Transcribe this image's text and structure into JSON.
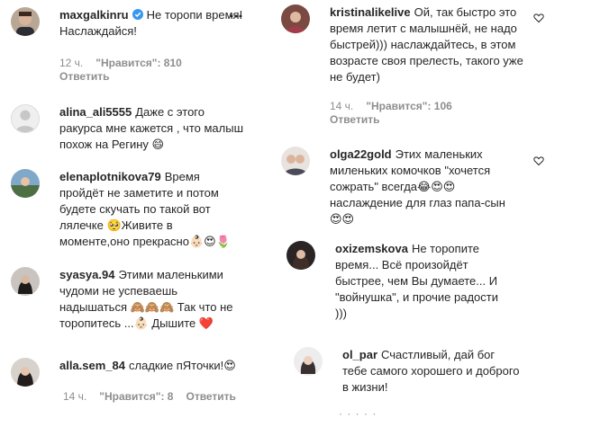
{
  "comments_left": [
    {
      "username": "maxgalkinru",
      "verified": true,
      "text": "Не торопи время! Наслаждайся!",
      "time": "12 ч.",
      "likes": "\"Нравится\": 810",
      "reply": "Ответить"
    },
    {
      "username": "alina_ali5555",
      "text": "Даже с этого ракурса мне кажется , что малыш похож на Регину",
      "emoji": "😄"
    },
    {
      "username": "elenaplotnikova79",
      "text": "Время пройдёт не заметите и потом будете скучать по такой вот лялечке 🥺Живите в моменте,оно прекрасно",
      "emoji": "👶🏻😍🌷"
    },
    {
      "username": "syasya.94",
      "text1": "Этими маленькими чудоми не успеваешь надышаться",
      "emoji1": "🙈🙈🙈",
      "text2": "Так что не торопитесь ...",
      "emoji2": "👶🏻",
      "text3": "Дышите",
      "emoji3": "❤️"
    },
    {
      "username": "alla.sem_84",
      "text": "сладкие пЯточки!",
      "emoji": "😍",
      "time": "14 ч.",
      "likes": "\"Нравится\": 8",
      "reply": "Ответить"
    }
  ],
  "comments_right": [
    {
      "username": "kristinalikelive",
      "text": "Ой, так быстро это время летит с малышнёй, не надо быстрей))) наслаждайтесь, в этом возрасте своя прелесть, такого уже не будет)",
      "time": "14 ч.",
      "likes": "\"Нравится\": 106",
      "reply": "Ответить"
    },
    {
      "username": "olga22gold",
      "text": "Этих маленьких миленьких комочков \"хочется сожрать\" всегда",
      "emoji": "😂😍😍",
      "text2": "наслаждение для глаз папа-сын",
      "emoji2": "😍😍"
    },
    {
      "username": "oxizemskova",
      "text": "Не торопите время... Всё произойдёт быстрее, чем Вы думаете... И \"войнушка\", и прочие радости )))"
    },
    {
      "username": "ol_par",
      "text": "Счастливый, дай бог тебе самого хорошего и доброго в жизни!"
    }
  ],
  "colors": {
    "text": "#262626",
    "meta": "#8e8e8e",
    "verified": "#3897f0"
  }
}
